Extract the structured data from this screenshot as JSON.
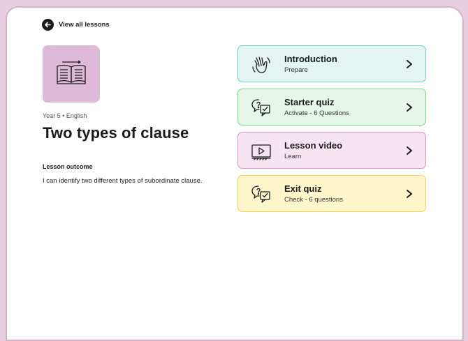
{
  "nav": {
    "back_label": "View all lessons"
  },
  "lesson": {
    "meta": "Year 5 • English",
    "title": "Two types of clause",
    "outcome_label": "Lesson outcome",
    "outcome_text": "I can identify two different types of subordinate clause."
  },
  "items": [
    {
      "title": "Introduction",
      "subtitle": "Prepare",
      "icon": "waving-hand-icon",
      "bg": "#e4f5f3",
      "border": "#6fd1c4"
    },
    {
      "title": "Starter quiz",
      "subtitle": "Activate - 6 Questions",
      "icon": "quiz-speech-bubbles-icon",
      "bg": "#e6f7e8",
      "border": "#7fd98c"
    },
    {
      "title": "Lesson video",
      "subtitle": "Learn",
      "icon": "video-player-icon",
      "bg": "#f6e5f0",
      "border": "#d994c3"
    },
    {
      "title": "Exit quiz",
      "subtitle": "Check - 6 questions",
      "icon": "quiz-speech-bubbles-icon",
      "bg": "#fff6cc",
      "border": "#f2d64d"
    }
  ],
  "colors": {
    "page_bg": "#e7cfdf",
    "thumb_bg": "#debad8"
  }
}
